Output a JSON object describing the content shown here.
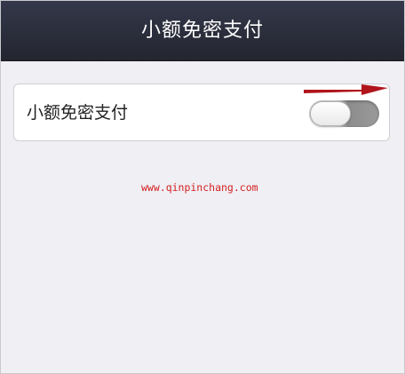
{
  "navbar": {
    "title": "小额免密支付"
  },
  "settings": {
    "small_payment_label": "小额免密支付",
    "small_payment_enabled": false
  },
  "watermark": {
    "text": "www.qinpinchang.com"
  },
  "colors": {
    "navbar_background": "#2b2e3b",
    "page_background": "#efeff4",
    "annotation_arrow": "#b0151b",
    "watermark_text": "#d42020"
  },
  "icons": {
    "annotation": "red-arrow-icon"
  }
}
